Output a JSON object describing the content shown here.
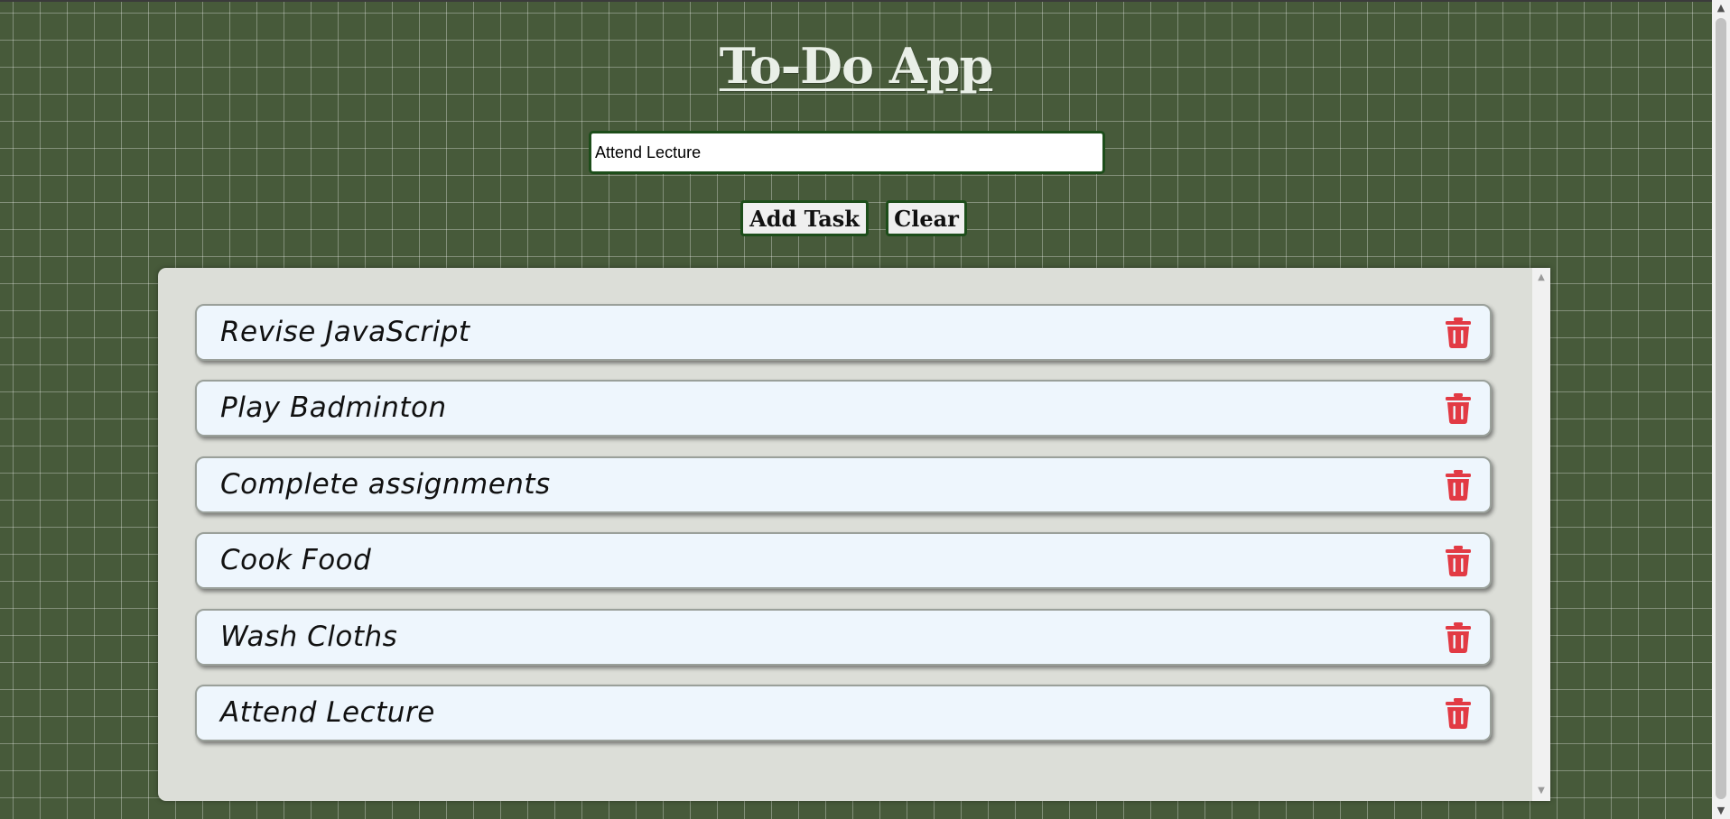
{
  "app": {
    "title": "To-Do App"
  },
  "input": {
    "value": "Attend Lecture",
    "placeholder": ""
  },
  "buttons": {
    "add_label": "Add Task",
    "clear_label": "Clear"
  },
  "tasks": [
    {
      "text": "Revise JavaScript",
      "delete_icon": "trash-icon"
    },
    {
      "text": "Play Badminton",
      "delete_icon": "trash-icon"
    },
    {
      "text": "Complete assignments",
      "delete_icon": "trash-icon"
    },
    {
      "text": "Cook Food",
      "delete_icon": "trash-icon"
    },
    {
      "text": "Wash Cloths",
      "delete_icon": "trash-icon"
    },
    {
      "text": "Attend Lecture",
      "delete_icon": "trash-icon"
    }
  ],
  "colors": {
    "background": "#475a3a",
    "delete_icon": "#e23a44",
    "button_border": "#1d4d1a",
    "task_bg": "#eef6fd"
  }
}
